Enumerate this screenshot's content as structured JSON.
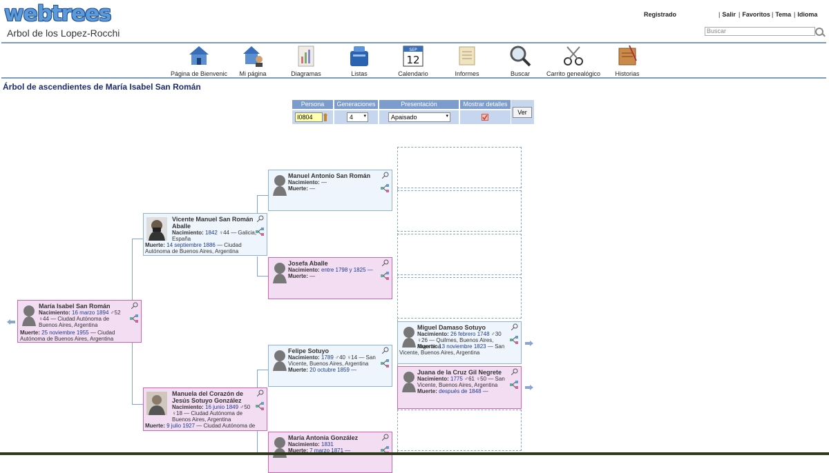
{
  "header": {
    "logo": "webtrees",
    "site_title": "Arbol de los Lopez-Rocchi",
    "registered": "Registrado",
    "links": [
      "Salir",
      "Favoritos",
      "Tema",
      "Idioma"
    ],
    "search_placeholder": "Buscar"
  },
  "nav": [
    {
      "label": "Página de Bienvenic",
      "icon": "home-icon"
    },
    {
      "label": "Mi página",
      "icon": "my-page-icon"
    },
    {
      "label": "Diagramas",
      "icon": "charts-icon"
    },
    {
      "label": "Listas",
      "icon": "lists-icon"
    },
    {
      "label": "Calendario",
      "icon": "calendar-icon"
    },
    {
      "label": "Informes",
      "icon": "reports-icon"
    },
    {
      "label": "Buscar",
      "icon": "search-magnifier-icon"
    },
    {
      "label": "Carrito genealógico",
      "icon": "scissors-icon"
    },
    {
      "label": "Historias",
      "icon": "stories-icon"
    }
  ],
  "calendar_day": "12",
  "calendar_month": "SEP",
  "page_heading": "Árbol de ascendientes de María Isabel San Román",
  "options": {
    "headers": [
      "Persona",
      "Generaciones",
      "Presentación",
      "Mostrar detalles"
    ],
    "person_value": "I0804",
    "generations_value": "4",
    "presentation_value": "Apaisado",
    "ver_label": "Ver"
  },
  "people": {
    "root": {
      "name": "María Isabel San Román",
      "birth_label": "Nacimiento:",
      "birth_date": "16 marzo 1894",
      "birth_ages": "♂52 ♀44",
      "birth_place": "— Ciudad Autónoma de Buenos Aires, Argentina",
      "death_label": "Muerte:",
      "death_date": "25 noviembre 1955",
      "death_place": "— Ciudad Autónoma de Buenos Aires, Argentina"
    },
    "father": {
      "name": "Vicente Manuel San Román Aballe",
      "birth_label": "Nacimiento:",
      "birth_date": "1842",
      "birth_ages": "♀44",
      "birth_place": "— Galicia, España",
      "death_label": "Muerte:",
      "death_date": "14 septiembre 1886",
      "death_place": "— Ciudad Autónoma de Buenos Aires, Argentina"
    },
    "mother": {
      "name": "Manuela del Corazón de Jesús Sotuyo González",
      "birth_label": "Nacimiento:",
      "birth_date": "16 junio 1849",
      "birth_ages": "♂50 ♀18",
      "birth_place": "— Ciudad Autónoma de Buenos Aires, Argentina",
      "death_label": "Muerte:",
      "death_date": "9 julio 1927",
      "death_place": "— Ciudad Autónoma de"
    },
    "ff": {
      "name": "Manuel Antonio San Román",
      "birth_label": "Nacimiento:",
      "birth_value": "—",
      "death_label": "Muerte:",
      "death_value": "—"
    },
    "fm": {
      "name": "Josefa Aballe",
      "birth_label": "Nacimiento:",
      "birth_value": "entre 1798 y 1825 —",
      "death_label": "Muerte:",
      "death_value": "—"
    },
    "mf": {
      "name": "Felipe Sotuyo",
      "birth_label": "Nacimiento:",
      "birth_date": "1789",
      "birth_ages": "♂40 ♀14",
      "birth_place": "— San Vicente, Buenos Aires, Argentina",
      "death_label": "Muerte:",
      "death_value": "20 octubre 1859 —"
    },
    "mm": {
      "name": "María Antonia González",
      "birth_label": "Nacimiento:",
      "birth_value": "1831",
      "death_label": "Muerte:",
      "death_value": "7 marzo 1871 —"
    },
    "mff": {
      "name": "Miguel Damaso Sotuyo",
      "birth_label": "Nacimiento:",
      "birth_date": "26 febrero 1748",
      "birth_ages": "♂30 ♀26",
      "birth_place": "— Quilmes, Buenos Aires, Argentina",
      "death_label": "Muerte:",
      "death_date": "13 noviembre 1823",
      "death_place": "— San Vicente, Buenos Aires, Argentina"
    },
    "mfm": {
      "name": "Juana de la Cruz Gil Negrete",
      "birth_label": "Nacimiento:",
      "birth_date": "1775",
      "birth_ages": "♂61 ♀50",
      "birth_place": "— San Vicente, Buenos Aires, Argentina",
      "death_label": "Muerte:",
      "death_value": "después de 1848 —"
    }
  },
  "colors": {
    "male_bg": "#eef5fc",
    "female_bg": "#f2ddf2",
    "heading": "#1c2a6e",
    "link": "#1c3a8a"
  }
}
